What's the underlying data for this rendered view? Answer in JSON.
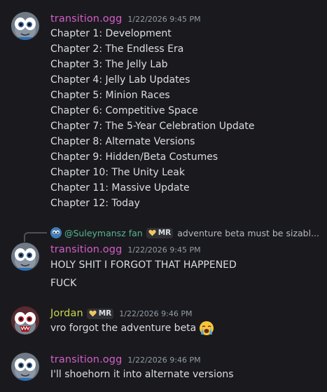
{
  "colors": {
    "background": "#1a1a1e",
    "username_transition": "#d35ec7",
    "username_jordan": "#c9d64f",
    "reply_name": "#57b590",
    "timestamp": "#949ba4",
    "heart": "#f0c75e"
  },
  "messages": [
    {
      "author": "transition.ogg",
      "timestamp": "1/22/2026 9:45 PM",
      "avatar": "gray-creature-avatar",
      "lines": [
        "Chapter 1: Development",
        "Chapter 2: The Endless Era",
        "Chapter 3: The Jelly Lab",
        "Chapter 4: Jelly Lab Updates",
        "Chapter 5: Minion Races",
        "Chapter 6: Competitive Space",
        "Chapter 7: The 5-Year Celebration Update",
        "Chapter 8: Alternate Versions",
        "Chapter 9: Hidden/Beta Costumes",
        "Chapter 10: The Unity Leak",
        "Chapter 11: Massive Update",
        "Chapter 12: Today"
      ]
    },
    {
      "reply": {
        "author": "@Suleymansz fan",
        "role": "MR",
        "content": "adventure beta must be sizabl..."
      },
      "author": "transition.ogg",
      "timestamp": "1/22/2026 9:45 PM",
      "avatar": "gray-creature-avatar",
      "lines": [
        "HOLY SHIT I FORGOT THAT HAPPENED",
        "FUCK"
      ]
    },
    {
      "author": "Jordan",
      "role": "MR",
      "timestamp": "1/22/2026 9:46 PM",
      "avatar": "red-creature-avatar",
      "lines": [
        "vro forgot the adventure beta"
      ],
      "emoji": "loudly-crying-face"
    },
    {
      "author": "transition.ogg",
      "timestamp": "1/22/2026 9:46 PM",
      "avatar": "gray-creature-avatar",
      "lines": [
        "I'll shoehorn it into alternate versions"
      ]
    }
  ]
}
